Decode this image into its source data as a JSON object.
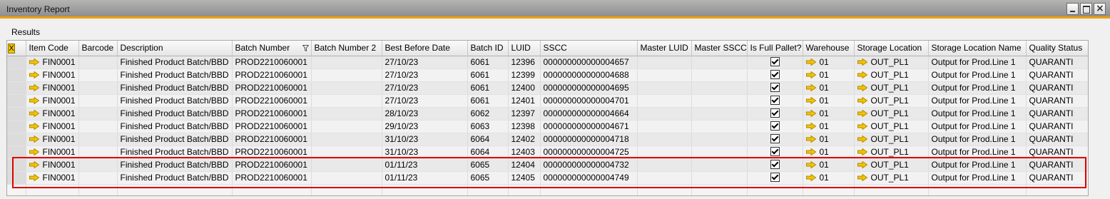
{
  "window": {
    "title": "Inventory Report"
  },
  "results_label": "Results",
  "grid": {
    "corner_label": "X",
    "columns": [
      "Item Code",
      "Barcode",
      "Description",
      "Batch Number",
      "Batch Number 2",
      "Best Before Date",
      "Batch ID",
      "LUID",
      "SSCC",
      "Master LUID",
      "Master SSCC",
      "Is Full Pallet?",
      "Warehouse",
      "Storage Location",
      "Storage Location Name",
      "Quality Status"
    ],
    "rows": [
      {
        "item": "FIN0001",
        "barcode": "",
        "desc": "Finished Product Batch/BBD",
        "batch": "PROD2210060001",
        "batch2": "",
        "bbd": "27/10/23",
        "batch_id": "6061",
        "luid": "12396",
        "sscc": "000000000000004657",
        "mluid": "",
        "msscc": "",
        "full": true,
        "wh": "01",
        "loc": "OUT_PL1",
        "loc_name": "Output for Prod.Line 1",
        "qs": "QUARANTI"
      },
      {
        "item": "FIN0001",
        "barcode": "",
        "desc": "Finished Product Batch/BBD",
        "batch": "PROD2210060001",
        "batch2": "",
        "bbd": "27/10/23",
        "batch_id": "6061",
        "luid": "12399",
        "sscc": "000000000000004688",
        "mluid": "",
        "msscc": "",
        "full": true,
        "wh": "01",
        "loc": "OUT_PL1",
        "loc_name": "Output for Prod.Line 1",
        "qs": "QUARANTI"
      },
      {
        "item": "FIN0001",
        "barcode": "",
        "desc": "Finished Product Batch/BBD",
        "batch": "PROD2210060001",
        "batch2": "",
        "bbd": "27/10/23",
        "batch_id": "6061",
        "luid": "12400",
        "sscc": "000000000000004695",
        "mluid": "",
        "msscc": "",
        "full": true,
        "wh": "01",
        "loc": "OUT_PL1",
        "loc_name": "Output for Prod.Line 1",
        "qs": "QUARANTI"
      },
      {
        "item": "FIN0001",
        "barcode": "",
        "desc": "Finished Product Batch/BBD",
        "batch": "PROD2210060001",
        "batch2": "",
        "bbd": "27/10/23",
        "batch_id": "6061",
        "luid": "12401",
        "sscc": "000000000000004701",
        "mluid": "",
        "msscc": "",
        "full": true,
        "wh": "01",
        "loc": "OUT_PL1",
        "loc_name": "Output for Prod.Line 1",
        "qs": "QUARANTI"
      },
      {
        "item": "FIN0001",
        "barcode": "",
        "desc": "Finished Product Batch/BBD",
        "batch": "PROD2210060001",
        "batch2": "",
        "bbd": "28/10/23",
        "batch_id": "6062",
        "luid": "12397",
        "sscc": "000000000000004664",
        "mluid": "",
        "msscc": "",
        "full": true,
        "wh": "01",
        "loc": "OUT_PL1",
        "loc_name": "Output for Prod.Line 1",
        "qs": "QUARANTI"
      },
      {
        "item": "FIN0001",
        "barcode": "",
        "desc": "Finished Product Batch/BBD",
        "batch": "PROD2210060001",
        "batch2": "",
        "bbd": "29/10/23",
        "batch_id": "6063",
        "luid": "12398",
        "sscc": "000000000000004671",
        "mluid": "",
        "msscc": "",
        "full": true,
        "wh": "01",
        "loc": "OUT_PL1",
        "loc_name": "Output for Prod.Line 1",
        "qs": "QUARANTI"
      },
      {
        "item": "FIN0001",
        "barcode": "",
        "desc": "Finished Product Batch/BBD",
        "batch": "PROD2210060001",
        "batch2": "",
        "bbd": "31/10/23",
        "batch_id": "6064",
        "luid": "12402",
        "sscc": "000000000000004718",
        "mluid": "",
        "msscc": "",
        "full": true,
        "wh": "01",
        "loc": "OUT_PL1",
        "loc_name": "Output for Prod.Line 1",
        "qs": "QUARANTI"
      },
      {
        "item": "FIN0001",
        "barcode": "",
        "desc": "Finished Product Batch/BBD",
        "batch": "PROD2210060001",
        "batch2": "",
        "bbd": "31/10/23",
        "batch_id": "6064",
        "luid": "12403",
        "sscc": "000000000000004725",
        "mluid": "",
        "msscc": "",
        "full": true,
        "wh": "01",
        "loc": "OUT_PL1",
        "loc_name": "Output for Prod.Line 1",
        "qs": "QUARANTI"
      },
      {
        "item": "FIN0001",
        "barcode": "",
        "desc": "Finished Product Batch/BBD",
        "batch": "PROD2210060001",
        "batch2": "",
        "bbd": "01/11/23",
        "batch_id": "6065",
        "luid": "12404",
        "sscc": "000000000000004732",
        "mluid": "",
        "msscc": "",
        "full": true,
        "wh": "01",
        "loc": "OUT_PL1",
        "loc_name": "Output for Prod.Line 1",
        "qs": "QUARANTI"
      },
      {
        "item": "FIN0001",
        "barcode": "",
        "desc": "Finished Product Batch/BBD",
        "batch": "PROD2210060001",
        "batch2": "",
        "bbd": "01/11/23",
        "batch_id": "6065",
        "luid": "12405",
        "sscc": "000000000000004749",
        "mluid": "",
        "msscc": "",
        "full": true,
        "wh": "01",
        "loc": "OUT_PL1",
        "loc_name": "Output for Prod.Line 1",
        "qs": "QUARANTI"
      }
    ]
  },
  "colors": {
    "accent": "#f0a000",
    "highlight": "#e00000",
    "link_arrow": "#f5c400"
  },
  "icons": {
    "filter": "filter-icon",
    "link": "link-arrow-icon",
    "checkbox": "checkbox-checked-icon"
  }
}
